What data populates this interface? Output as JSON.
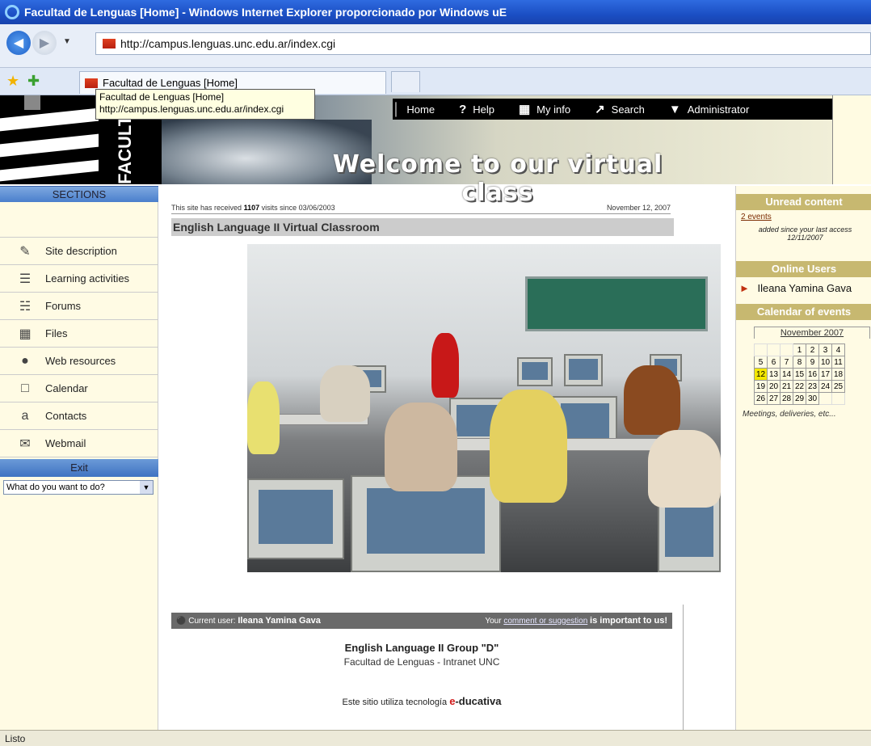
{
  "browser": {
    "title": "Facultad de Lenguas [Home] - Windows Internet Explorer proporcionado por Windows uE",
    "url": "http://campus.lenguas.unc.edu.ar/index.cgi",
    "tab_label": "Facultad de Lenguas [Home]",
    "tooltip_line1": "Facultad de Lenguas [Home]",
    "tooltip_line2": "http://campus.lenguas.unc.edu.ar/index.cgi",
    "status": "Listo"
  },
  "header": {
    "logo_text": "FACULTAD LENGU",
    "welcome": "Welcome to our virtual class",
    "nav": [
      {
        "label": "Home",
        "icon": "pencil-icon"
      },
      {
        "label": "Help",
        "icon": "question-icon"
      },
      {
        "label": "My info",
        "icon": "info-icon"
      },
      {
        "label": "Search",
        "icon": "search-icon"
      },
      {
        "label": "Administrator",
        "icon": "admin-icon"
      }
    ]
  },
  "sidebar": {
    "sections_title": "SECTIONS",
    "items": [
      {
        "label": "Site description",
        "icon": "description-icon"
      },
      {
        "label": "Learning activities",
        "icon": "activities-icon"
      },
      {
        "label": "Forums",
        "icon": "forums-icon"
      },
      {
        "label": "Files",
        "icon": "files-icon"
      },
      {
        "label": "Web resources",
        "icon": "globe-icon"
      },
      {
        "label": "Calendar",
        "icon": "calendar-icon"
      },
      {
        "label": "Contacts",
        "icon": "contacts-icon"
      },
      {
        "label": "Webmail",
        "icon": "mail-icon"
      }
    ],
    "exit_title": "Exit",
    "exit_select": "What do you want to do?"
  },
  "main": {
    "visits_prefix": "This site has received",
    "visits_count": "1107",
    "visits_suffix": "visits since 03/06/2003",
    "date": "November 12, 2007",
    "class_title": "English Language II Virtual Classroom"
  },
  "right": {
    "unread_title": "Unread content",
    "unread_link": "2 events",
    "unread_note": "added since your last access 12/11/2007",
    "online_title": "Online Users",
    "online_user": "Ileana Yamina Gava",
    "calendar_title": "Calendar of events",
    "calendar_month": "November 2007",
    "calendar_weeks": [
      [
        "",
        "",
        "",
        "1",
        "2",
        "3",
        "4"
      ],
      [
        "5",
        "6",
        "7",
        "8",
        "9",
        "10",
        "11"
      ],
      [
        "12",
        "13",
        "14",
        "15",
        "16",
        "17",
        "18"
      ],
      [
        "19",
        "20",
        "21",
        "22",
        "23",
        "24",
        "25"
      ],
      [
        "26",
        "27",
        "28",
        "29",
        "30",
        "",
        ""
      ]
    ],
    "calendar_today": "12",
    "calendar_note": "Meetings, deliveries, etc..."
  },
  "footer": {
    "current_user_label": "Current user:",
    "current_user": "Ileana Yamina Gava",
    "comment_prefix": "Your",
    "comment_link": "comment or suggestion",
    "comment_suffix": "is important to us!",
    "group": "English Language II Group \"D\"",
    "faculty": "Facultad de Lenguas - Intranet UNC",
    "tech_prefix": "Este sitio utiliza tecnología",
    "brand_e": "e",
    "brand_rest": "-ducativa"
  }
}
